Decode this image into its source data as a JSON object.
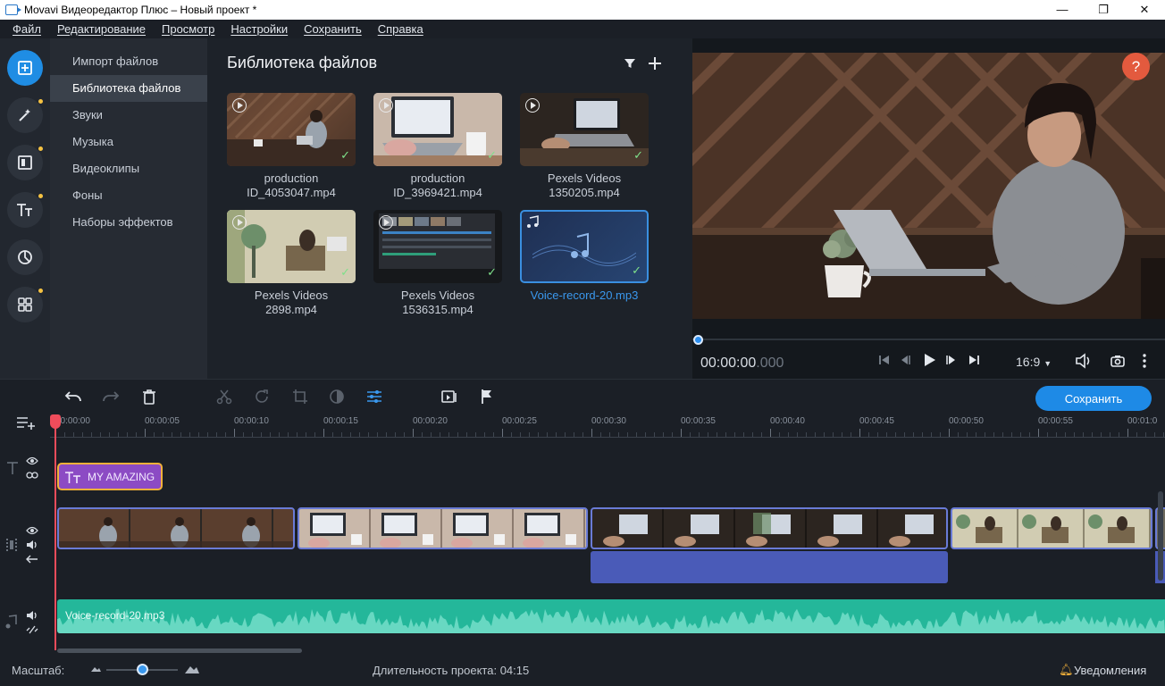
{
  "window": {
    "title": "Movavi Видеоредактор Плюс – Новый проект *",
    "controls": [
      "—",
      "❐",
      "✕"
    ]
  },
  "menu": [
    "Файл",
    "Редактирование",
    "Просмотр",
    "Настройки",
    "Сохранить",
    "Справка"
  ],
  "sidenav": [
    {
      "label": "Импорт файлов",
      "active": false
    },
    {
      "label": "Библиотека файлов",
      "active": true
    },
    {
      "label": "Звуки",
      "active": false
    },
    {
      "label": "Музыка",
      "active": false
    },
    {
      "label": "Видеоклипы",
      "active": false
    },
    {
      "label": "Фоны",
      "active": false
    },
    {
      "label": "Наборы эффектов",
      "active": false
    }
  ],
  "library": {
    "title": "Библиотека файлов",
    "items": [
      {
        "line1": "production",
        "line2": "ID_4053047.mp4",
        "type": "video"
      },
      {
        "line1": "production",
        "line2": "ID_3969421.mp4",
        "type": "video"
      },
      {
        "line1": "Pexels Videos",
        "line2": "1350205.mp4",
        "type": "video"
      },
      {
        "line1": "Pexels Videos",
        "line2": "2898.mp4",
        "type": "video"
      },
      {
        "line1": "Pexels Videos",
        "line2": "1536315.mp4",
        "type": "video"
      },
      {
        "line1": "Voice-record-20.mp3",
        "line2": "",
        "type": "audio"
      }
    ]
  },
  "preview": {
    "timecode_main": "00:00:00",
    "timecode_ms": ".000",
    "aspect": "16:9",
    "help": "?"
  },
  "toolbar": {
    "save_label": "Сохранить"
  },
  "ruler": {
    "ticks": [
      "00:00:00",
      "00:00:05",
      "00:00:10",
      "00:00:15",
      "00:00:20",
      "00:00:25",
      "00:00:30",
      "00:00:35",
      "00:00:40",
      "00:00:45",
      "00:00:50",
      "00:00:55",
      "00:01:0"
    ]
  },
  "tracks": {
    "title_clip": "MY AMAZING",
    "audio_clip": "Voice-record-20.mp3"
  },
  "status": {
    "zoom_label": "Масштаб:",
    "zoom_level": 0.5,
    "duration_label": "Длительность проекта:",
    "duration_value": "04:15",
    "notifications": "Уведомления"
  },
  "colors": {
    "accent": "#1e8ae6",
    "title_clip": "#8c4bc4",
    "title_clip_border": "#f2b13a",
    "audio_track": "#24b79a",
    "video_border": "#6a7bd6",
    "blue_bar": "#4a5bb8"
  }
}
